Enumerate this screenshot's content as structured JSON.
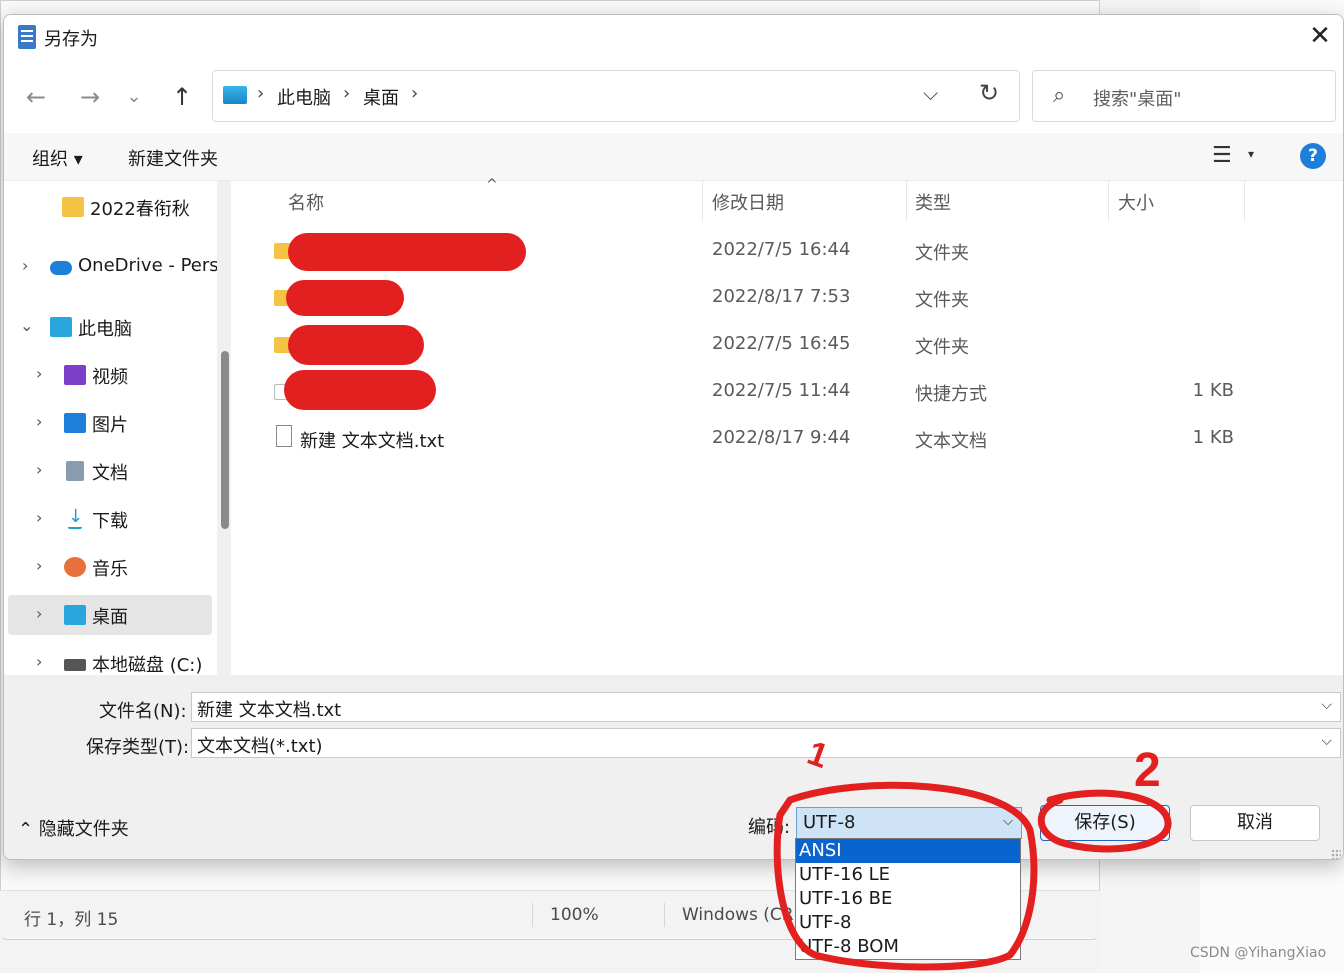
{
  "background": {
    "status_position": "行 1，列 15",
    "status_zoom": "100%",
    "status_encoding": "Windows (CRLF)"
  },
  "dialog": {
    "title": "另存为",
    "close_glyph": "✕"
  },
  "nav": {
    "back": "←",
    "forward": "→",
    "recent": "⌄",
    "up": "↑",
    "breadcrumbs": [
      "此电脑",
      "桌面"
    ],
    "crumb_sep": "›",
    "dropdown": "⌵",
    "refresh": "↻",
    "search_placeholder": "搜索\"桌面\"",
    "search_glyph": "⌕"
  },
  "commands": {
    "organize": "组织 ▾",
    "new_folder": "新建文件夹",
    "view_glyph": "☰",
    "view_dd": "▾",
    "help": "?"
  },
  "sidebar": [
    {
      "label": "2022春衔秋",
      "color": "#f4c343"
    },
    {
      "label": "OneDrive - Pers",
      "color": "#1e7fd8"
    },
    {
      "label": "此电脑",
      "color": "#2aa6de"
    },
    {
      "label": "视频",
      "color": "#7b3fc8"
    },
    {
      "label": "图片",
      "color": "#1e7fd8"
    },
    {
      "label": "文档",
      "color": "#8a9bb0"
    },
    {
      "label": "下载",
      "color": "#1e9fd8"
    },
    {
      "label": "音乐",
      "color": "#e8703a"
    },
    {
      "label": "桌面",
      "color": "#2aa6de"
    },
    {
      "label": "本地磁盘 (C:)",
      "color": "#555555"
    }
  ],
  "sidebar_arrows": {
    "collapsed": "›",
    "expanded": "⌄"
  },
  "columns": {
    "name": "名称",
    "sort": "^",
    "date": "修改日期",
    "type": "类型",
    "size": "大小"
  },
  "files": [
    {
      "name": "",
      "date": "2022/7/5 16:44",
      "type": "文件夹",
      "size": ""
    },
    {
      "name": "",
      "date": "2022/8/17 7:53",
      "type": "文件夹",
      "size": ""
    },
    {
      "name": "",
      "date": "2022/7/5 16:45",
      "type": "文件夹",
      "size": ""
    },
    {
      "name": "",
      "date": "2022/7/5 11:44",
      "type": "快捷方式",
      "size": "1 KB"
    },
    {
      "name": "新建 文本文档.txt",
      "date": "2022/8/17 9:44",
      "type": "文本文档",
      "size": "1 KB"
    }
  ],
  "form": {
    "filename_label": "文件名(N):",
    "filename_value": "新建 文本文档.txt",
    "filetype_label": "保存类型(T):",
    "filetype_value": "文本文档(*.txt)",
    "field_dd": "⌵"
  },
  "footer": {
    "hide_folders": "⌃ 隐藏文件夹",
    "encoding_label": "编码:",
    "encoding_value": "UTF-8",
    "encoding_dd": "⌵",
    "save": "保存(S)",
    "cancel": "取消"
  },
  "encoding_options": [
    "ANSI",
    "UTF-16 LE",
    "UTF-16 BE",
    "UTF-8",
    "UTF-8 BOM"
  ],
  "annotations": {
    "mark1": "1",
    "mark2": "2",
    "color": "#e32020"
  },
  "watermark": "CSDN @YihangXiao"
}
